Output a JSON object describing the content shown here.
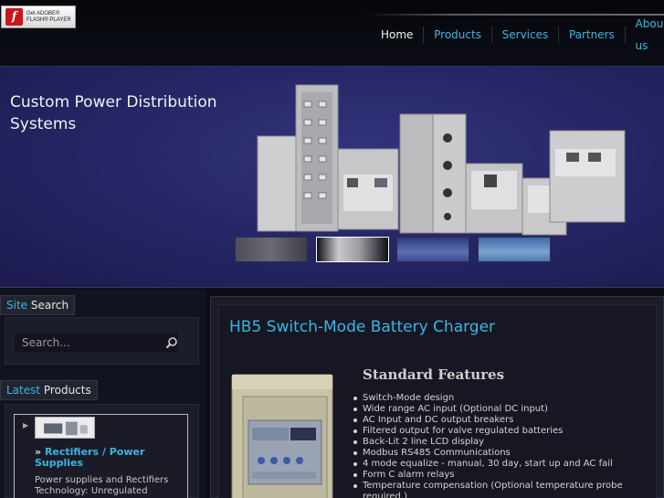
{
  "flash_badge": {
    "logo_letter": "f",
    "line1": "Get ADOBE®",
    "line2": "FLASH® PLAYER"
  },
  "nav": {
    "items": [
      {
        "label": "Home",
        "active": true
      },
      {
        "label": "Products",
        "active": false
      },
      {
        "label": "Services",
        "active": false
      },
      {
        "label": "Partners",
        "active": false
      },
      {
        "label": "About us",
        "active": false
      }
    ]
  },
  "banner": {
    "title": "Custom Power Distribution Systems",
    "slideshow": {
      "slide_count": 4,
      "selected_index": 1
    }
  },
  "sidebar": {
    "search_tab": {
      "accent": "Site",
      "rest": " Search"
    },
    "search_placeholder": "Search...",
    "products_tab": {
      "accent": "Latest",
      "rest": " Products"
    },
    "product": {
      "raquo": "»",
      "name": "Rectifiers / Power Supplies",
      "description": "Power supplies and Rectifiers Technology: Unregulated"
    }
  },
  "main": {
    "title": "HB5 Switch-Mode Battery Charger",
    "features_title": "Standard Features",
    "features": [
      "Switch-Mode design",
      "Wide range AC input (Optional DC input)",
      "AC Input and DC output breakers",
      "Filtered output for valve regulated batteries",
      "Back-Lit 2 line LCD display",
      "Modbus RS485 Communications",
      "4 mode equalize - manual, 30 day, start up and AC fail",
      "Form C alarm relays",
      "Temperature compensation (Optional temperature probe required.)"
    ]
  },
  "colors": {
    "accent": "#37b7e3",
    "background": "#0c0d14",
    "banner": "#272768"
  }
}
